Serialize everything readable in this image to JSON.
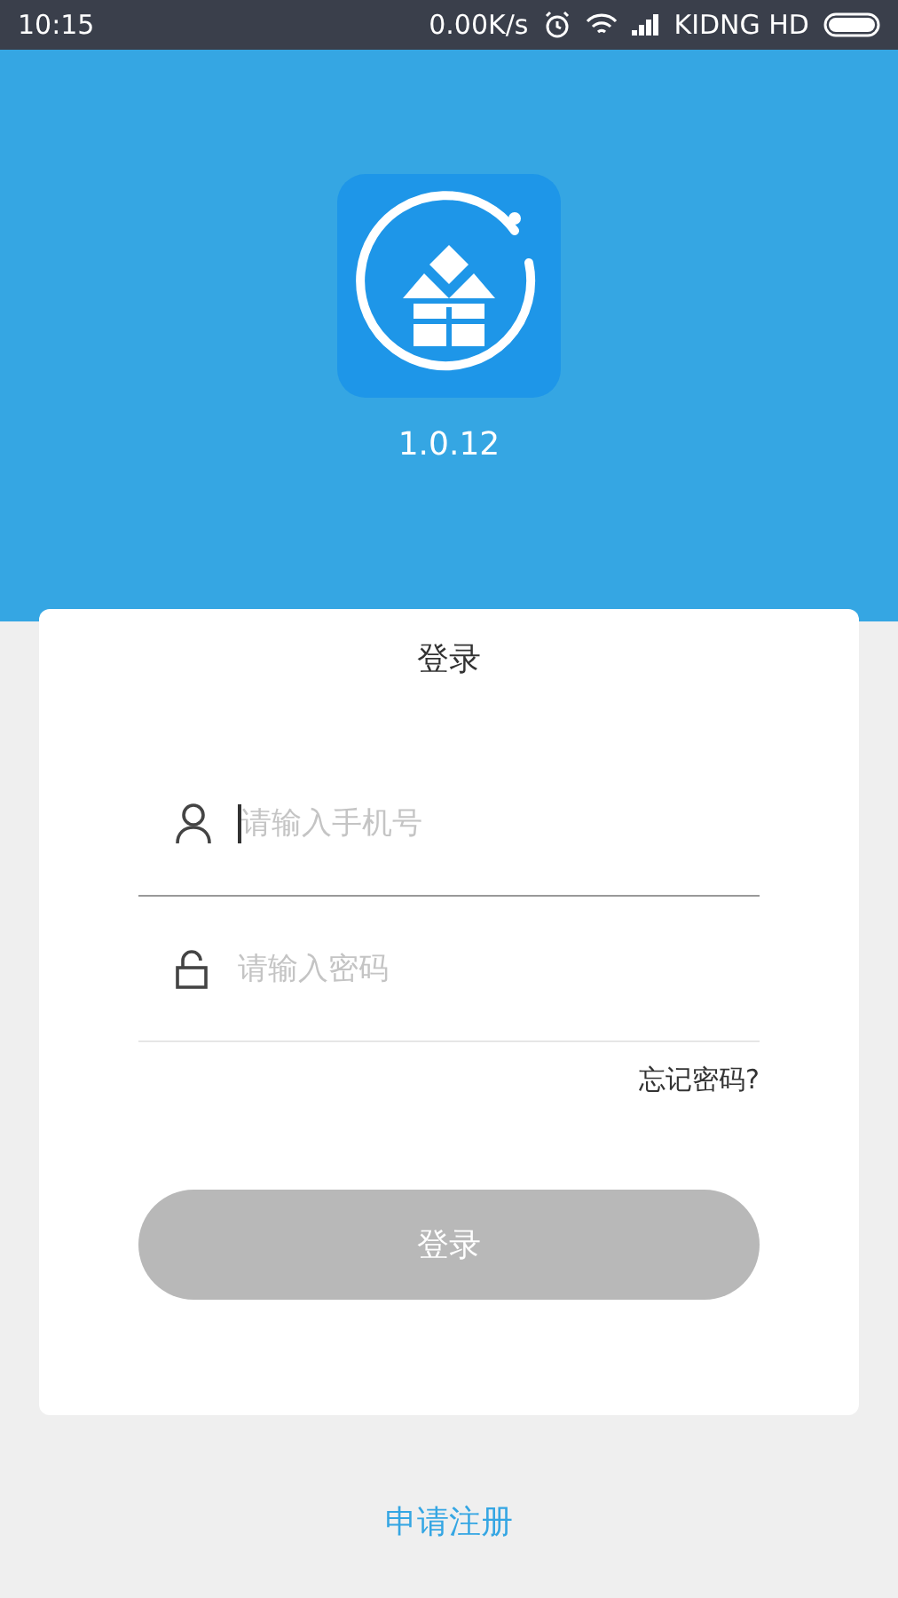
{
  "status_bar": {
    "time": "10:15",
    "speed": "0.00K/s",
    "carrier": "KIDNG HD"
  },
  "header": {
    "version": "1.0.12"
  },
  "login_card": {
    "title": "登录",
    "fields": [
      {
        "kind": "phone",
        "placeholder": "请输入手机号",
        "focused": true
      },
      {
        "kind": "password",
        "placeholder": "请输入密码",
        "focused": false
      }
    ],
    "forgot_link": "忘记密码?",
    "login_button": {
      "label": "登录",
      "disabled": true
    }
  },
  "register_link": "申请注册"
}
